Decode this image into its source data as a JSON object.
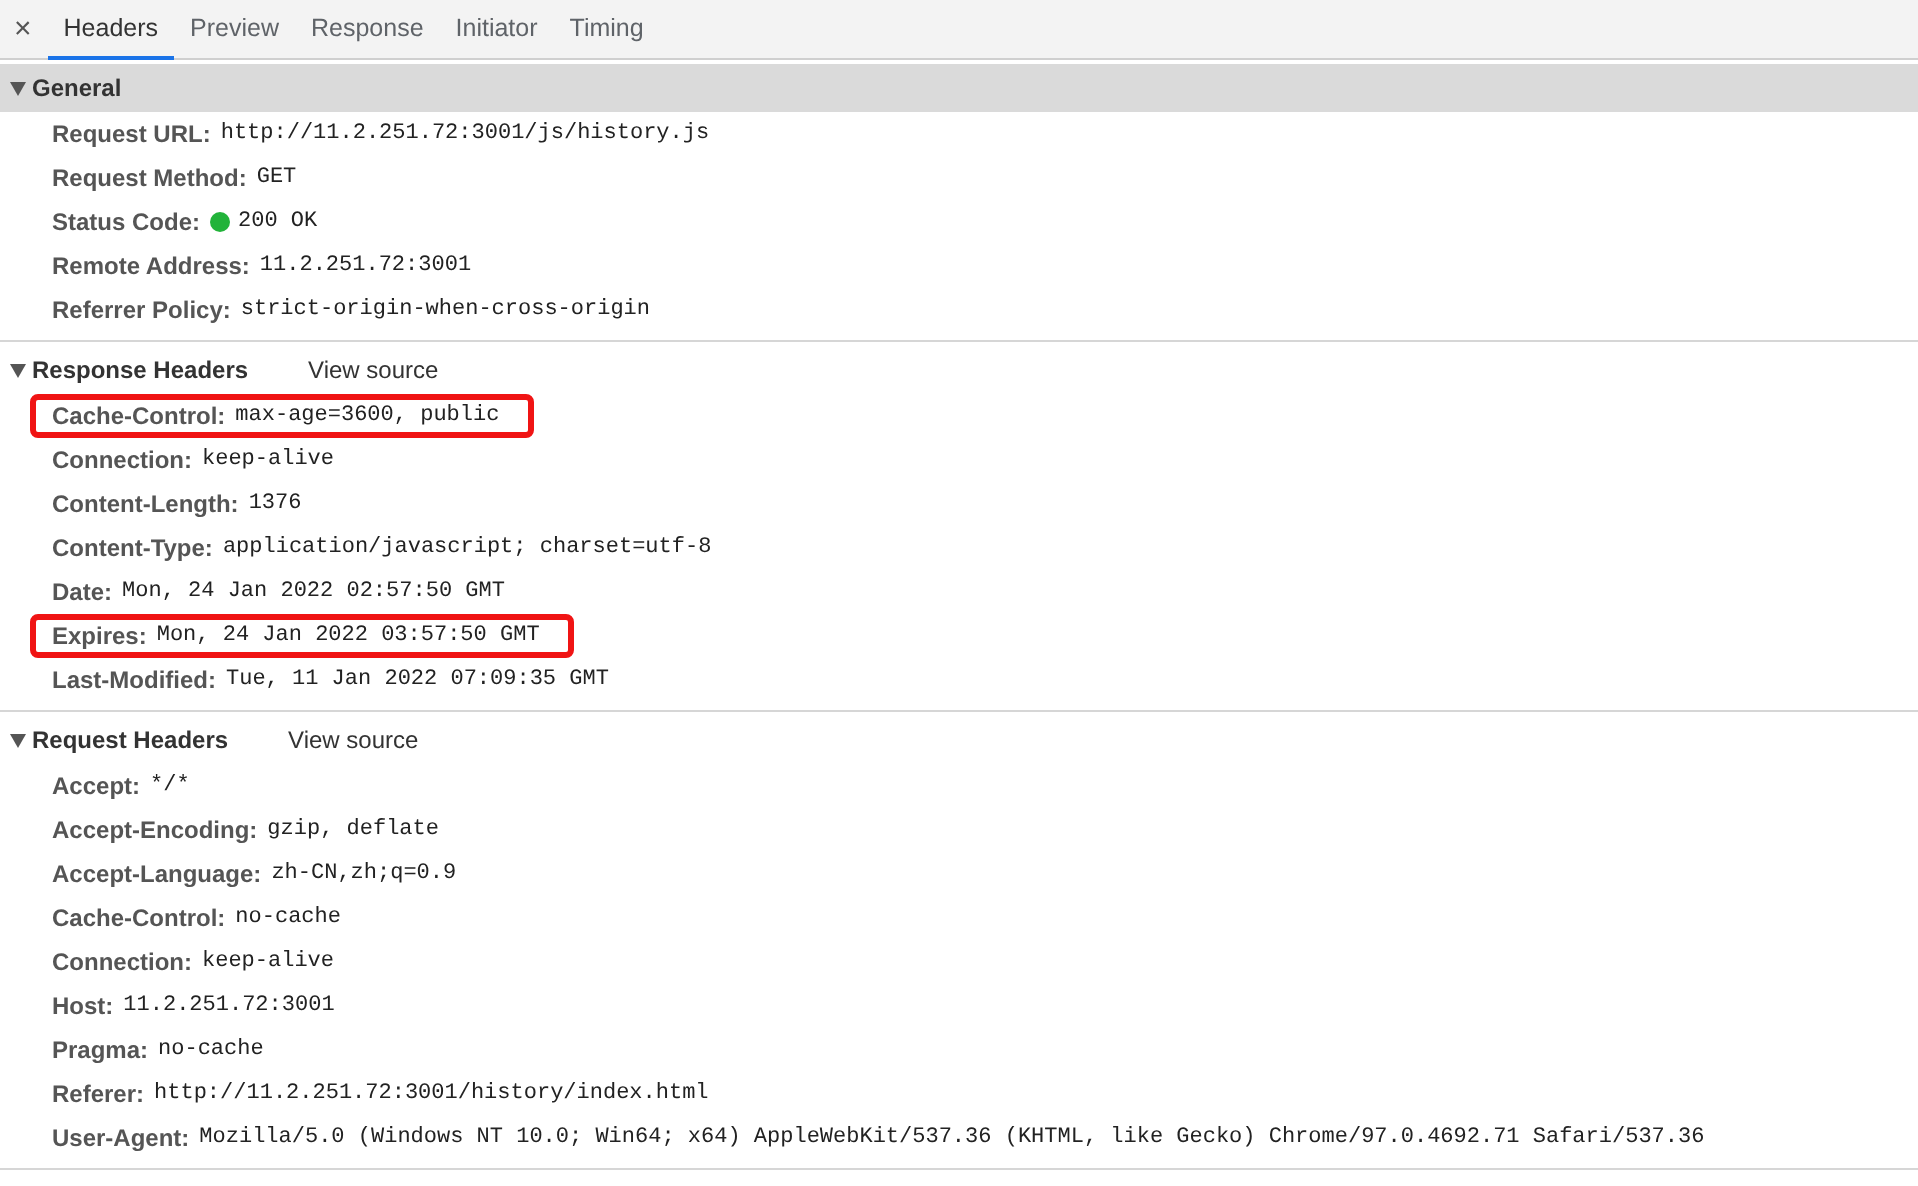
{
  "close_button": "×",
  "tabs": [
    {
      "label": "Headers",
      "selected": true
    },
    {
      "label": "Preview",
      "selected": false
    },
    {
      "label": "Response",
      "selected": false
    },
    {
      "label": "Initiator",
      "selected": false
    },
    {
      "label": "Timing",
      "selected": false
    }
  ],
  "sections": [
    {
      "title": "General",
      "expanded": true,
      "selected": true,
      "rows": [
        {
          "name": "Request URL:",
          "value": "http://11.2.251.72:3001/js/history.js",
          "highlighted": false
        },
        {
          "name": "Request Method:",
          "value": "GET",
          "highlighted": false
        },
        {
          "name": "Status Code:",
          "value": "200 OK",
          "highlighted": false,
          "color": "#22b33a"
        },
        {
          "name": "Remote Address:",
          "value": "11.2.251.72:3001",
          "highlighted": false
        },
        {
          "name": "Referrer Policy:",
          "value": "strict-origin-when-cross-origin",
          "highlighted": false
        }
      ]
    },
    {
      "title": "Response Headers",
      "view_source": "View source",
      "expanded": true,
      "selected": false,
      "rows": [
        {
          "name": "Cache-Control:",
          "value": "max-age=3600, public",
          "highlighted": true
        },
        {
          "name": "Connection:",
          "value": "keep-alive",
          "highlighted": false
        },
        {
          "name": "Content-Length:",
          "value": "1376",
          "highlighted": false
        },
        {
          "name": "Content-Type:",
          "value": "application/javascript; charset=utf-8",
          "highlighted": false
        },
        {
          "name": "Date:",
          "value": "Mon, 24 Jan 2022 02:57:50 GMT",
          "highlighted": false
        },
        {
          "name": "Expires:",
          "value": "Mon, 24 Jan 2022 03:57:50 GMT",
          "highlighted": true
        },
        {
          "name": "Last-Modified:",
          "value": "Tue, 11 Jan 2022 07:09:35 GMT",
          "highlighted": false
        }
      ]
    },
    {
      "title": "Request Headers",
      "view_source": "View source",
      "expanded": true,
      "selected": false,
      "rows": [
        {
          "name": "Accept:",
          "value": "*/*",
          "highlighted": false
        },
        {
          "name": "Accept-Encoding:",
          "value": "gzip, deflate",
          "highlighted": false
        },
        {
          "name": "Accept-Language:",
          "value": "zh-CN,zh;q=0.9",
          "highlighted": false
        },
        {
          "name": "Cache-Control:",
          "value": "no-cache",
          "highlighted": false
        },
        {
          "name": "Connection:",
          "value": "keep-alive",
          "highlighted": false
        },
        {
          "name": "Host:",
          "value": "11.2.251.72:3001",
          "highlighted": false
        },
        {
          "name": "Pragma:",
          "value": "no-cache",
          "highlighted": false
        },
        {
          "name": "Referer:",
          "value": "http://11.2.251.72:3001/history/index.html",
          "highlighted": false
        },
        {
          "name": "User-Agent:",
          "value": "Mozilla/5.0 (Windows NT 10.0; Win64; x64) AppleWebKit/537.36 (KHTML, like Gecko) Chrome/97.0.4692.71 Safari/537.36",
          "highlighted": false
        }
      ]
    }
  ]
}
